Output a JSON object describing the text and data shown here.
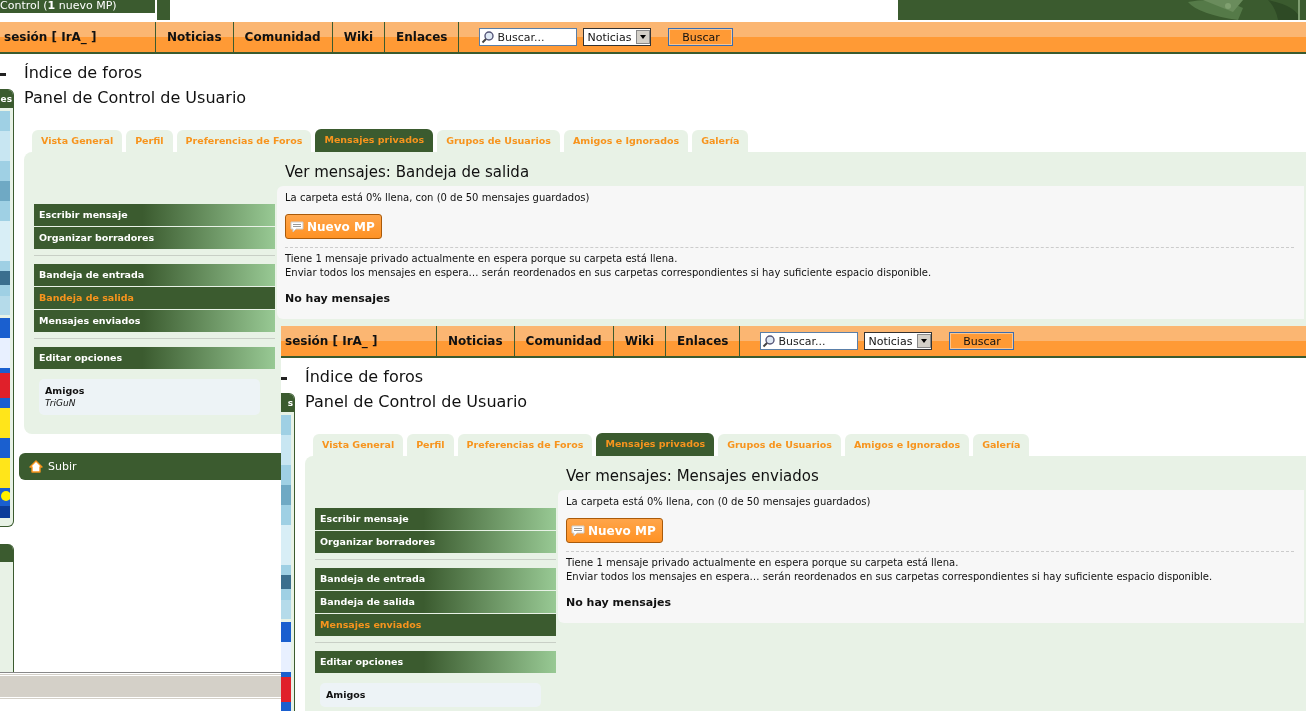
{
  "back_window": {
    "header": {
      "user_panel_link": "Control (**1** nuevo MP)"
    },
    "navbar": {
      "user_link": "sesión [ IrA_ ]",
      "links": [
        "Noticias",
        "Comunidad",
        "Wiki",
        "Enlaces"
      ],
      "search": {
        "placeholder": "Buscar..."
      },
      "category": "Noticias",
      "button": "Buscar"
    },
    "side_box_title": "es",
    "breadcrumb": "Índice de foros",
    "page_title": "Panel de Control de Usuario",
    "tabs": [
      {
        "label": "Vista General",
        "selected": false
      },
      {
        "label": "Perfil",
        "selected": false
      },
      {
        "label": "Preferencias de Foros",
        "selected": false
      },
      {
        "label": "Mensajes privados",
        "selected": true
      },
      {
        "label": "Grupos de Usuarios",
        "selected": false
      },
      {
        "label": "Amigos e Ignorados",
        "selected": false
      },
      {
        "label": "Galería",
        "selected": false
      }
    ],
    "menu": [
      [
        {
          "label": "Escribir mensaje",
          "selected": false
        },
        {
          "label": "Organizar borradores",
          "selected": false
        }
      ],
      [
        {
          "label": "Bandeja de entrada",
          "selected": false
        },
        {
          "label": "Bandeja de salida",
          "selected": true
        },
        {
          "label": "Mensajes enviados",
          "selected": false
        }
      ],
      [
        {
          "label": "Editar opciones",
          "selected": false
        }
      ]
    ],
    "friends": {
      "title": "Amigos",
      "names": [
        "TriGuN"
      ]
    },
    "content": {
      "title": "Ver mensajes: Bandeja de salida",
      "folder_status": "La carpeta está 0% llena, con (0 de 50 mensajes guardados)",
      "new_button": "Nuevo MP",
      "notices": [
        "Tiene 1 mensaje privado actualmente en espera porque su carpeta está llena.",
        "Enviar todos los mensajes en espera… serán reordenados en sus carpetas correspondientes si hay suficiente espacio disponible."
      ],
      "empty_message": "No hay mensajes"
    },
    "back_to_top": "Subir"
  },
  "front_window": {
    "navbar": {
      "user_link": "sesión [ IrA_ ]",
      "links": [
        "Noticias",
        "Comunidad",
        "Wiki",
        "Enlaces"
      ],
      "search": {
        "placeholder": "Buscar..."
      },
      "category": "Noticias",
      "button": "Buscar"
    },
    "side_box_title": "s",
    "breadcrumb": "Índice de foros",
    "page_title": "Panel de Control de Usuario",
    "tabs": [
      {
        "label": "Vista General",
        "selected": false
      },
      {
        "label": "Perfil",
        "selected": false
      },
      {
        "label": "Preferencias de Foros",
        "selected": false
      },
      {
        "label": "Mensajes privados",
        "selected": true
      },
      {
        "label": "Grupos de Usuarios",
        "selected": false
      },
      {
        "label": "Amigos e Ignorados",
        "selected": false
      },
      {
        "label": "Galería",
        "selected": false
      }
    ],
    "menu": [
      [
        {
          "label": "Escribir mensaje",
          "selected": false
        },
        {
          "label": "Organizar borradores",
          "selected": false
        }
      ],
      [
        {
          "label": "Bandeja de entrada",
          "selected": false
        },
        {
          "label": "Bandeja de salida",
          "selected": false
        },
        {
          "label": "Mensajes enviados",
          "selected": true
        }
      ],
      [
        {
          "label": "Editar opciones",
          "selected": false
        }
      ]
    ],
    "friends": {
      "title": "Amigos"
    },
    "content": {
      "title": "Ver mensajes: Mensajes enviados",
      "folder_status": "La carpeta está 0% llena, con (0 de 50 mensajes guardados)",
      "new_button": "Nuevo MP",
      "notices": [
        "Tiene 1 mensaje privado actualmente en espera porque su carpeta está llena.",
        "Enviar todos los mensajes en espera… serán reordenados en sus carpetas correspondientes si hay suficiente espacio disponible."
      ],
      "empty_message": "No hay mensajes"
    }
  }
}
